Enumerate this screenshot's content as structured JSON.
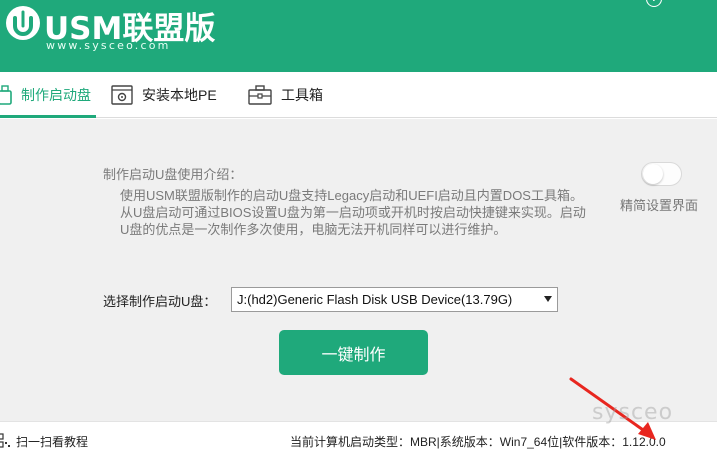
{
  "app": {
    "brand": "USM联盟版",
    "url": "www.sysceo.com",
    "help_glyph": "?",
    "accent_color": "#1fa97b"
  },
  "tabs": [
    {
      "label": "制作启动盘",
      "icon": "usb-drive-icon",
      "active": true
    },
    {
      "label": "安装本地PE",
      "icon": "gear-install-icon",
      "active": false
    },
    {
      "label": "工具箱",
      "icon": "toolbox-icon",
      "active": false
    }
  ],
  "intro": {
    "title": "制作启动U盘使用介绍：",
    "text": "使用USM联盟版制作的启动U盘支持Legacy启动和UEFI启动且内置DOS工具箱。从U盘启动可通过BIOS设置U盘为第一启动项或开机时按启动快捷键来实现。启动U盘的优点是一次制作多次使用，电脑无法开机同样可以进行维护。"
  },
  "toggle": {
    "label": "精简设置界面",
    "on": false
  },
  "select": {
    "label": "选择制作启动U盘：",
    "value": "J:(hd2)Generic Flash Disk USB Device(13.79G)"
  },
  "make_button": "一键制作",
  "footer": {
    "scan_label": "扫一扫看教程",
    "status": "当前计算机启动类型：MBR|系统版本：Win7_64位|软件版本：1.12.0.0"
  },
  "watermark": "sysceo"
}
